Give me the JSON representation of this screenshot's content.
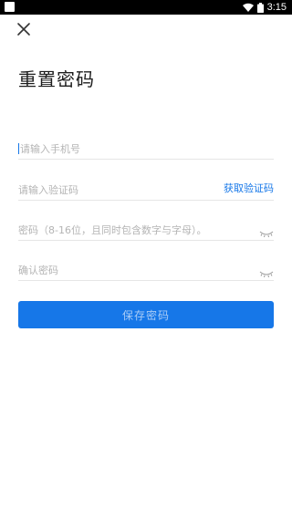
{
  "status_bar": {
    "time": "3:15"
  },
  "page": {
    "title": "重置密码"
  },
  "form": {
    "phone": {
      "placeholder": "请输入手机号",
      "value": ""
    },
    "code": {
      "placeholder": "请输入验证码",
      "value": "",
      "get_code_label": "获取验证码"
    },
    "password": {
      "placeholder": "密码（8-16位，且同时包含数字与字母）。",
      "value": ""
    },
    "confirm": {
      "placeholder": "确认密码",
      "value": ""
    },
    "submit_label": "保存密码"
  },
  "colors": {
    "accent": "#1677e8",
    "button_text": "#a9ccf6",
    "placeholder": "#b4b4b4",
    "divider": "#e6e6e6"
  },
  "icons": {
    "close": "close-icon",
    "eye": "eye-closed-icon",
    "wifi": "wifi-icon",
    "battery": "battery-icon"
  }
}
